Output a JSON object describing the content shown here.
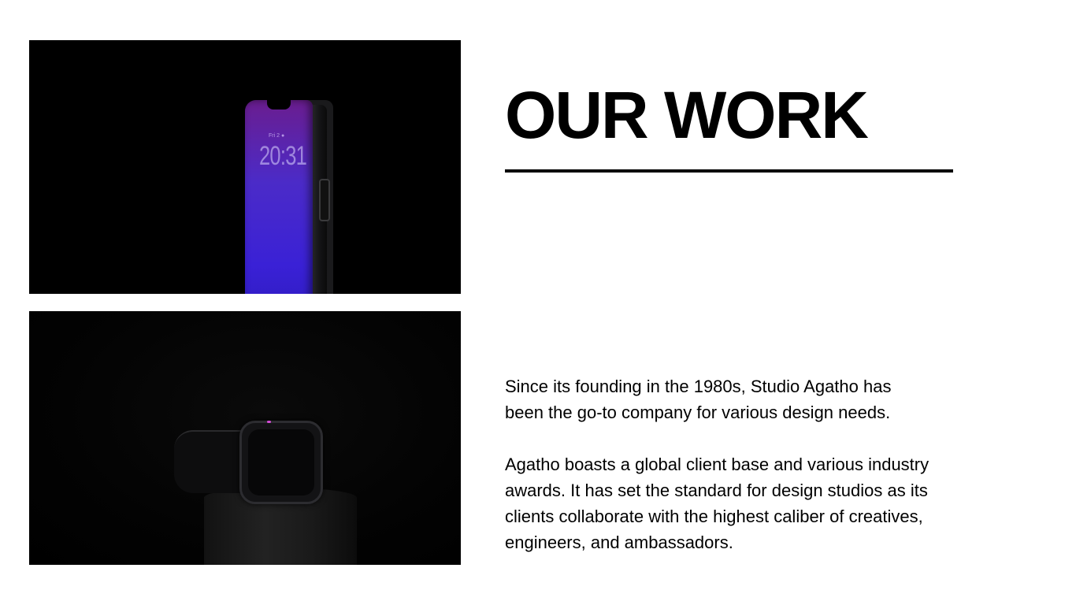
{
  "images": {
    "phone": {
      "lock_date": "Fri 2 ●",
      "lock_time": "20:31"
    },
    "watch": {}
  },
  "section": {
    "title": "OUR WORK",
    "paragraphs": [
      "Since its founding in the 1980s, Studio Agatho has been the go-to company for various design needs.",
      "Agatho boasts a global client base and various industry awards. It has set the standard for design studios as its clients collaborate with the highest caliber of creatives, engineers, and ambassadors."
    ]
  },
  "colors": {
    "background": "#ffffff",
    "text": "#000000",
    "photo_background": "#000000",
    "phone_screen": "#4b2bc8"
  }
}
